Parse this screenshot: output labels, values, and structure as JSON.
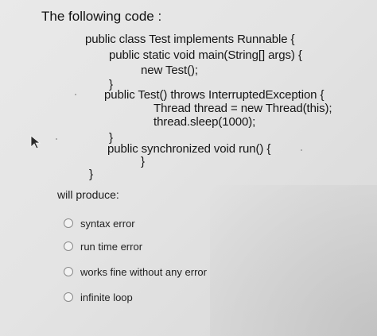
{
  "question": {
    "title": "The following code :",
    "code_lines": [
      "public class Test implements Runnable {",
      "public static void main(String[] args) {",
      "new Test();",
      "}",
      "public Test() throws InterruptedException {",
      "Thread thread = new Thread(this);",
      "thread.sleep(1000);",
      "}",
      "public synchronized void run() {",
      "}",
      "}"
    ],
    "prompt": "will produce:",
    "options": [
      "syntax error",
      "run time error",
      "works fine without any error",
      "infinite loop"
    ]
  },
  "icons": {
    "cursor": "mouse-pointer-icon"
  },
  "colors": {
    "background": "#e5e5e5",
    "text": "#1c1c1c"
  }
}
